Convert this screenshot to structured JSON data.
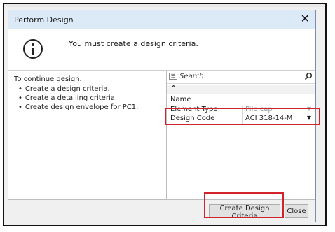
{
  "dialog": {
    "title": "Perform Design",
    "close_glyph": "✕",
    "message": "You must create a design criteria.",
    "message_icon": "info-icon"
  },
  "instructions": {
    "heading": "To continue design.",
    "items": [
      "Create a design criteria.",
      "Create a detailing criteria.",
      "Create design envelope for PC1."
    ]
  },
  "properties": {
    "search_placeholder": "Search",
    "collapse_glyph": "⌃",
    "group_label": "Name",
    "rows": [
      {
        "name": "Element Type",
        "value": "Pile cap",
        "disabled": true
      },
      {
        "name": "Design Code",
        "value": "ACI 318-14-M",
        "disabled": false
      }
    ]
  },
  "footer": {
    "create_label": "Create Design Criteria",
    "close_label": "Close"
  },
  "colors": {
    "titlebar": "#dce9f7",
    "highlight": "#d2232a"
  }
}
